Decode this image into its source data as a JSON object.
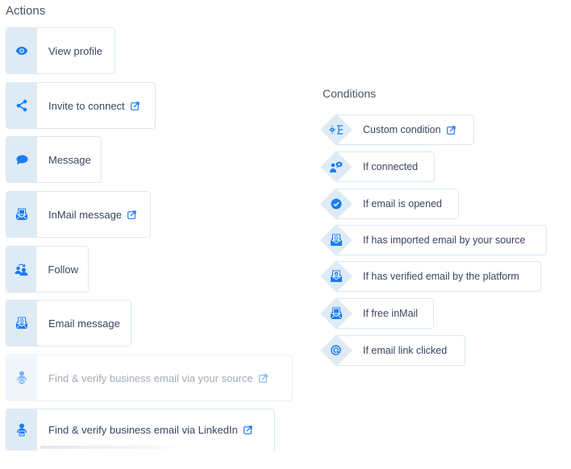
{
  "actions": {
    "title": "Actions",
    "items": [
      {
        "label": "View profile",
        "icon": "eye-icon",
        "external": false,
        "disabled": false
      },
      {
        "label": "Invite to connect",
        "icon": "share-icon",
        "external": true,
        "disabled": false
      },
      {
        "label": "Message",
        "icon": "chat-bubble-icon",
        "external": false,
        "disabled": false
      },
      {
        "label": "InMail message",
        "icon": "inmail-envelope-icon",
        "external": true,
        "disabled": false
      },
      {
        "label": "Follow",
        "icon": "follow-users-icon",
        "external": false,
        "disabled": false
      },
      {
        "label": "Email message",
        "icon": "email-envelope-icon",
        "external": false,
        "disabled": false
      },
      {
        "label": "Find & verify business email via your source",
        "icon": "person-email-icon",
        "external": true,
        "disabled": true
      },
      {
        "label": "Find & verify business email via LinkedIn",
        "icon": "person-linkedin-icon",
        "external": true,
        "disabled": false
      }
    ]
  },
  "conditions": {
    "title": "Conditions",
    "items": [
      {
        "label": "Custom condition",
        "icon": "custom-condition-icon",
        "external": true
      },
      {
        "label": "If connected",
        "icon": "connected-users-icon",
        "external": false
      },
      {
        "label": "If email is opened",
        "icon": "check-circle-icon",
        "external": false
      },
      {
        "label": "If has imported email by your source",
        "icon": "email-envelope-icon",
        "external": false
      },
      {
        "label": "If has verified email by the platform",
        "icon": "verified-envelope-icon",
        "external": false
      },
      {
        "label": "If free inMail",
        "icon": "inmail-envelope-icon",
        "external": false
      },
      {
        "label": "If email link clicked",
        "icon": "link-click-icon",
        "external": false
      }
    ]
  },
  "colors": {
    "accent": "#1a7cf5",
    "icon_bg": "#deebf5",
    "border": "#dbe8f1",
    "text": "#3c4560",
    "disabled_text": "#a6abb8"
  }
}
